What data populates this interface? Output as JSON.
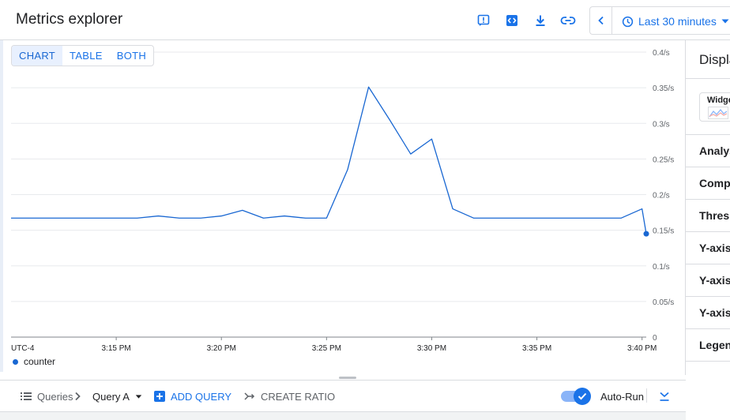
{
  "header": {
    "title": "Metrics explorer",
    "icons": [
      "feedback-icon",
      "code-icon",
      "download-icon",
      "link-icon"
    ],
    "time_range": {
      "label": "Last 30 minutes"
    }
  },
  "view_toggle": {
    "buttons": [
      "CHART",
      "TABLE",
      "BOTH"
    ],
    "active": "CHART"
  },
  "chart_data": {
    "type": "line",
    "timezone_label": "UTC-4",
    "x_tick_labels": [
      "3:15 PM",
      "3:20 PM",
      "3:25 PM",
      "3:30 PM",
      "3:35 PM",
      "3:40 PM"
    ],
    "y_tick_labels": [
      "0",
      "0.05/s",
      "0.1/s",
      "0.15/s",
      "0.2/s",
      "0.25/s",
      "0.3/s",
      "0.35/s",
      "0.4/s"
    ],
    "ylim": [
      0,
      0.4
    ],
    "y_unit": "/s",
    "grid": true,
    "legend_position": "bottom-left",
    "x_minutes_after_3pm": [
      10.0,
      11.0,
      12.0,
      13.0,
      14.0,
      15.0,
      16.0,
      17.0,
      18.0,
      19.0,
      20.0,
      21.0,
      22.0,
      23.0,
      24.0,
      25.0,
      26.0,
      27.0,
      28.0,
      29.0,
      30.0,
      31.0,
      32.0,
      33.0,
      34.0,
      35.0,
      36.0,
      37.0,
      38.0,
      39.0,
      40.0,
      40.2
    ],
    "series": [
      {
        "name": "counter",
        "color": "#1967d2",
        "values": [
          0.167,
          0.167,
          0.167,
          0.167,
          0.167,
          0.167,
          0.167,
          0.17,
          0.167,
          0.167,
          0.17,
          0.178,
          0.167,
          0.17,
          0.167,
          0.167,
          0.235,
          0.351,
          0.305,
          0.257,
          0.278,
          0.18,
          0.167,
          0.167,
          0.167,
          0.167,
          0.167,
          0.167,
          0.167,
          0.167,
          0.18,
          0.145
        ]
      }
    ]
  },
  "query_bar": {
    "queries_label": "Queries",
    "query_name": "Query A",
    "add_query": "ADD QUERY",
    "create_ratio": "CREATE RATIO",
    "auto_run": "Auto-Run",
    "auto_run_on": true
  },
  "right_panel": {
    "title": "Display",
    "widget_label": "Widget",
    "sections": [
      "Analysis",
      "Compare",
      "Threshold",
      "Y-axis",
      "Y-axis",
      "Y-axis",
      "Legend"
    ]
  },
  "colors": {
    "accent": "#1a73e8",
    "series": "#1967d2",
    "grid": "#e8eaed",
    "border": "#dadce0"
  }
}
